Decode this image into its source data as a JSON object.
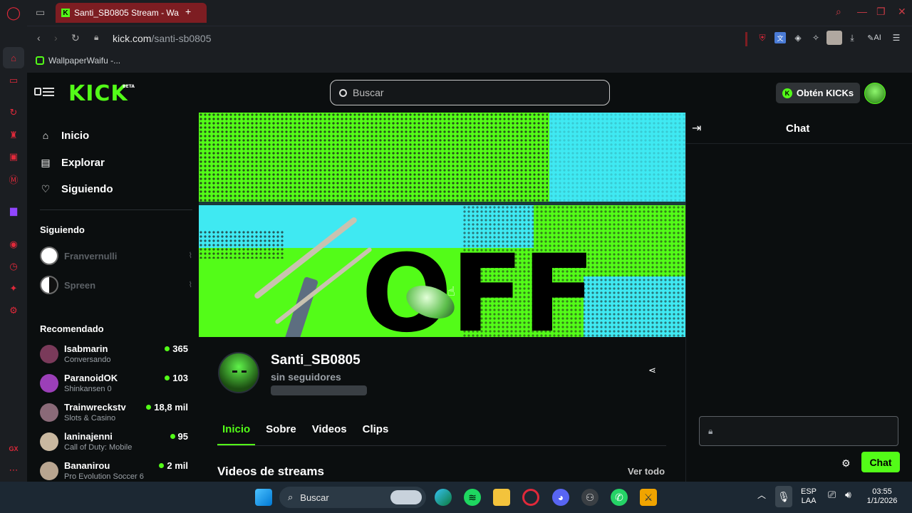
{
  "browser": {
    "tab_title": "Santi_SB0805 Stream - Wa",
    "tab_favicon": "K",
    "new_tab": "+",
    "url_host": "kick.com",
    "url_path": "/santi-sb0805",
    "bookmark": "WallpaperWaifu -...",
    "ai_label": "AI"
  },
  "kick": {
    "beta": "BETA",
    "logo": "KICK",
    "search_placeholder": "Buscar",
    "get_kicks": "Obtén KICKs",
    "nav": [
      {
        "label": "Inicio",
        "icon": "home-icon"
      },
      {
        "label": "Explorar",
        "icon": "compass-icon"
      },
      {
        "label": "Siguiendo",
        "icon": "heart-icon"
      }
    ],
    "following_title": "Siguiendo",
    "following": [
      {
        "name": "Franvernulli"
      },
      {
        "name": "Spreen"
      }
    ],
    "recommended_title": "Recomendado",
    "recommended": [
      {
        "name": "Isabmarin",
        "category": "Conversando",
        "viewers": "365",
        "color": "#7a3a5a"
      },
      {
        "name": "ParanoidOK",
        "category": "Shinkansen 0",
        "viewers": "103",
        "color": "#9b3fb8"
      },
      {
        "name": "Trainwreckstv",
        "category": "Slots & Casino",
        "viewers": "18,8 mil",
        "color": "#8a6a78"
      },
      {
        "name": "laninajenni",
        "category": "Call of Duty: Mobile",
        "viewers": "95",
        "color": "#c9b8a0"
      },
      {
        "name": "Bananirou",
        "category": "Pro Evolution Soccer 6",
        "viewers": "2 mil",
        "color": "#b8a590"
      }
    ],
    "channel": {
      "name": "Santi_SB0805",
      "followers": "sin seguidores"
    },
    "tabs": [
      "Inicio",
      "Sobre",
      "Videos",
      "Clips"
    ],
    "videos_heading": "Videos de streams",
    "see_all": "Ver todo",
    "chat_title": "Chat",
    "chat_button": "Chat",
    "accent": "#53fc18"
  },
  "taskbar": {
    "search": "Buscar",
    "lang_top": "ESP",
    "lang_bottom": "LAA",
    "time": "03:55",
    "date": "1/1/2026"
  }
}
